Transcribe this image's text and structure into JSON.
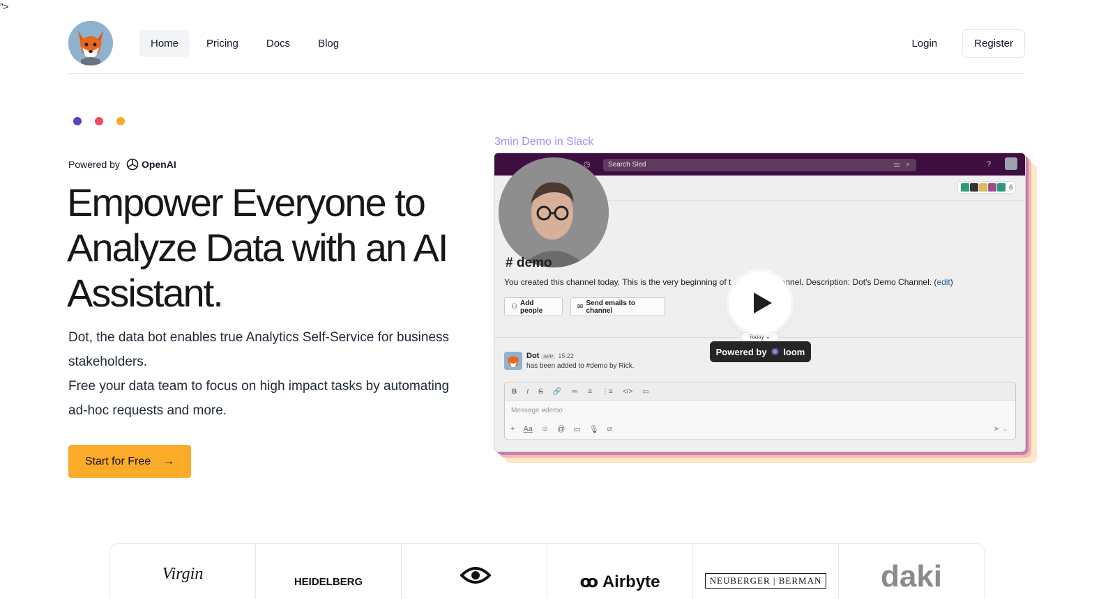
{
  "stray_text": "\">",
  "brand": {
    "logo": "fox-logo"
  },
  "nav": {
    "items": [
      {
        "label": "Home",
        "active": true
      },
      {
        "label": "Pricing",
        "active": false
      },
      {
        "label": "Docs",
        "active": false
      },
      {
        "label": "Blog",
        "active": false
      }
    ],
    "login": "Login",
    "register": "Register"
  },
  "decor_dots": [
    "#5b3fc4",
    "#ef4d63",
    "#fbab27"
  ],
  "hero": {
    "powered_by": "Powered by",
    "openai": "OpenAI",
    "title": "Empower Everyone to Analyze Data with an AI Assistant.",
    "desc_line1": "Dot, the data bot enables true Analytics Self-Service for business stakeholders.",
    "desc_line2": "Free your data team to focus on high impact tasks by automating ad-hoc requests and more.",
    "cta": "Start for Free",
    "cta_arrow": "→"
  },
  "video": {
    "label": "3min Demo in Slack",
    "search": "Search Sled",
    "member_count": "6",
    "channel": "# demo",
    "channel_desc_a": "You created this channel today. This is the very beginning of t",
    "channel_desc_b": "channel. Description: Dot's Demo Channel. (",
    "channel_desc_edit": "edit",
    "channel_desc_end": ")",
    "add_people": "Add people",
    "send_emails": "Send emails to channel",
    "today": "Today ⌄",
    "powered_by": "Powered by",
    "loom": "loom",
    "msg_name": "Dot",
    "msg_app": "APP",
    "msg_time": "15:22",
    "msg_text": "has been added to #demo by Rick.",
    "composer_placeholder": "Message #demo",
    "composer_tools": [
      "B",
      "I",
      "S",
      "🔗",
      "≔",
      "≡",
      "⋮≡",
      "</>",
      "▭"
    ],
    "composer_bottom": [
      "+",
      "Aa",
      "☺",
      "@",
      "▭",
      "🎙",
      "⧄"
    ]
  },
  "logos": [
    "Virgin",
    "HEIDELBERG",
    "eye-logo",
    "Airbyte",
    "NEUBERGER | BERMAN",
    "daki"
  ]
}
